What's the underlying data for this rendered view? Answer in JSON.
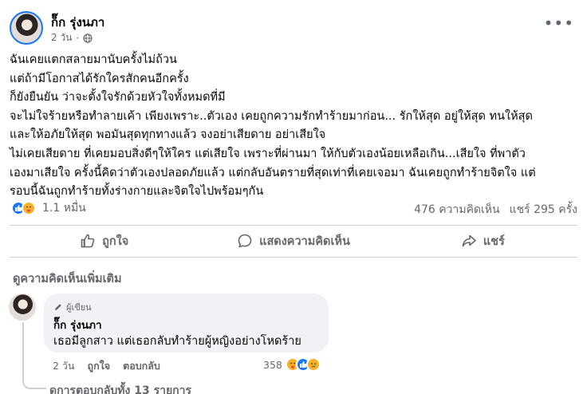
{
  "post": {
    "author": "ก็๊ก รุ่งนภา",
    "time": "2 วัน",
    "separator": "·",
    "more_icon": "more-horizontal-icon",
    "lines": [
      "ฉันเคยแตกสลายมานับครั้งไม่ถ้วน",
      "แต่ถ้ามีโอกาสได้รักใครสักคนอีกครั้ง",
      "ก็ยังยืนยัน ว่าจะตั้งใจรักด้วยหัวใจทั้งหมดที่มี",
      "จะไม่ใจร้ายหรือทำลายเค้า  เพียงเพราะ..ตัวเอง เคยถูกความรักทำร้ายมาก่อน...  รักให้สุด อยู่ให้สุด ทนให้สุด",
      "และให้อภัยให้สุด พอมันสุดทุกทางแล้ว จงอย่าเสียดาย อย่าเสียใจ",
      "ไม่เคยเสียดาย ที่เคยมอบสิ่งดีๆให้ใคร แต่เสียใจ เพราะที่ผ่านมา ให้กับตัวเองน้อยเหลือเกิน...เสียใจ ที่พาตัว",
      "เองมาเสียใจ ครั้งนี้คิดว่าตัวเองปลอดภัยแล้ว แต่กลับอันตรายที่สุดเท่าที่เคยเจอมา ฉันเคยถูกทำร้ายจิตใจ แต่",
      "รอบนี้ฉันถูกทำร้ายทั้งร่างกายและจิตใจไปพร้อมๆกัน"
    ],
    "reaction_count": "1.1 หมื่น",
    "comments": "476 ความคิดเห็น",
    "shares": "แชร์ 295 ครั้ง"
  },
  "actions": {
    "like": "ถูกใจ",
    "comment": "แสดงความคิดเห็น",
    "share": "แชร์"
  },
  "comments_section": {
    "more_label": "ดูความคิดเห็นเพิ่มเติม",
    "comment": {
      "badge": "ผู้เขียน",
      "name": "ก็๊ก รุ่งนภา",
      "text": "เธอมีลูกสาว แต่เธอกลับทำร้ายผู้หญิงอย่างโหดร้าย",
      "time": "2 วัน",
      "like": "ถูกใจ",
      "reply": "ตอบกลับ",
      "reaction_count": "358"
    },
    "view_replies": "ดูการตอบกลับทั้ง 13 รายการ"
  },
  "colors": {
    "like_blue": "#1877f2",
    "emoji_yellow": "#f7b125",
    "muted_text": "#65676b",
    "bubble": "#f0f2f5"
  }
}
